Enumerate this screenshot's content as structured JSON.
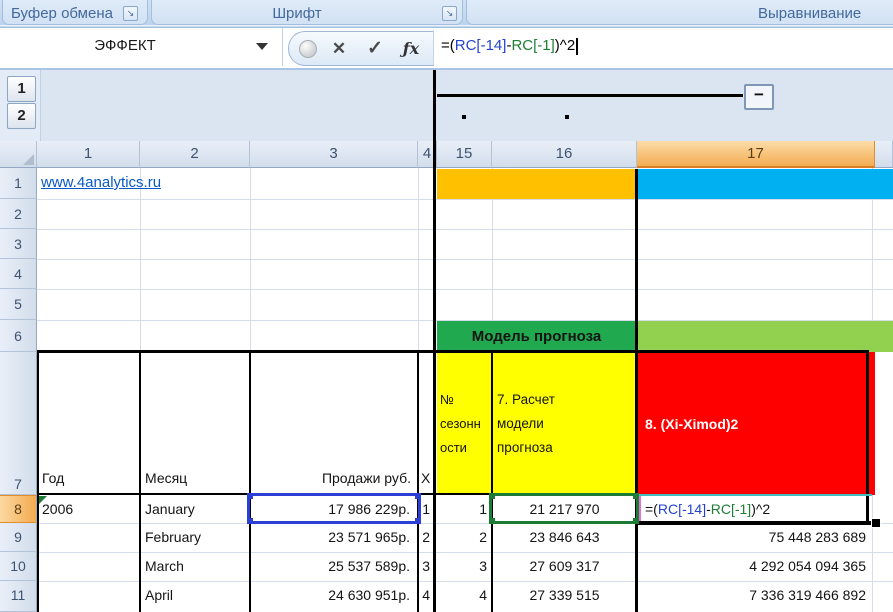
{
  "ribbon": {
    "groups": [
      {
        "label": "Буфер обмена",
        "dialog_launcher": "↘"
      },
      {
        "label": "Шрифт",
        "dialog_launcher": "↘"
      },
      {
        "label": "Выравнивание",
        "dialog_launcher": ""
      }
    ]
  },
  "formula_bar": {
    "name_box_value": "ЭФФЕКТ",
    "cancel_glyph": "✕",
    "enter_glyph": "✓",
    "fx_glyph": "ƒx",
    "formula": {
      "full": "=(RC[-14]-RC[-1])^2",
      "seg_open": "=(",
      "ref1": "RC[-14]",
      "seg_minus": "-",
      "ref2": "RC[-1]",
      "seg_close": ")^2"
    }
  },
  "outline": {
    "level_buttons": [
      "1",
      "2"
    ],
    "collapse_button": "−"
  },
  "grid": {
    "column_headers": [
      "1",
      "2",
      "3",
      "4",
      "15",
      "16",
      "17"
    ],
    "selected_column": "17",
    "row_headers": [
      "1",
      "2",
      "3",
      "4",
      "5",
      "6",
      "7",
      "8",
      "9",
      "10",
      "11"
    ],
    "selected_row": "8"
  },
  "cells": {
    "link": "www.4analytics.ru",
    "model_title": "Модель прогноза",
    "r7": {
      "year": "Год",
      "month": "Месяц",
      "sales": "Продажи руб.",
      "x": "X",
      "season": "№ сезонности",
      "calc": "7. Расчет модели прогноза",
      "sq": "8. (Xi-Ximod)2"
    },
    "r8": {
      "year": "2006",
      "month": "January",
      "sales": "17 986 229р.",
      "x": "1",
      "season": "1",
      "model": "21 217 970"
    },
    "r9": {
      "month": "February",
      "sales": "23 571 965р.",
      "x": "2",
      "season": "2",
      "model": "23 846 643",
      "sq": "75 448 283 689"
    },
    "r10": {
      "month": "March",
      "sales": "25 537 589р.",
      "x": "3",
      "season": "3",
      "model": "27 609 317",
      "sq": "4 292 054 094 365"
    },
    "r11": {
      "month": "April",
      "sales": "24 630 951р.",
      "x": "4",
      "season": "4",
      "model": "27 339 515",
      "sq": "7 336 319 466 892"
    }
  },
  "colors": {
    "orange_fill": "#FFC000",
    "blue_fill": "#00B0F0",
    "green_fill": "#00B050",
    "light_green_fill": "#92D050",
    "yellow_fill": "#FFFF00",
    "red_fill": "#FF0000",
    "reference_blue": "#2442CE",
    "reference_green": "#1E7E35",
    "link_blue": "#0A58C8",
    "selected_header_orange": "#F3AD52"
  }
}
